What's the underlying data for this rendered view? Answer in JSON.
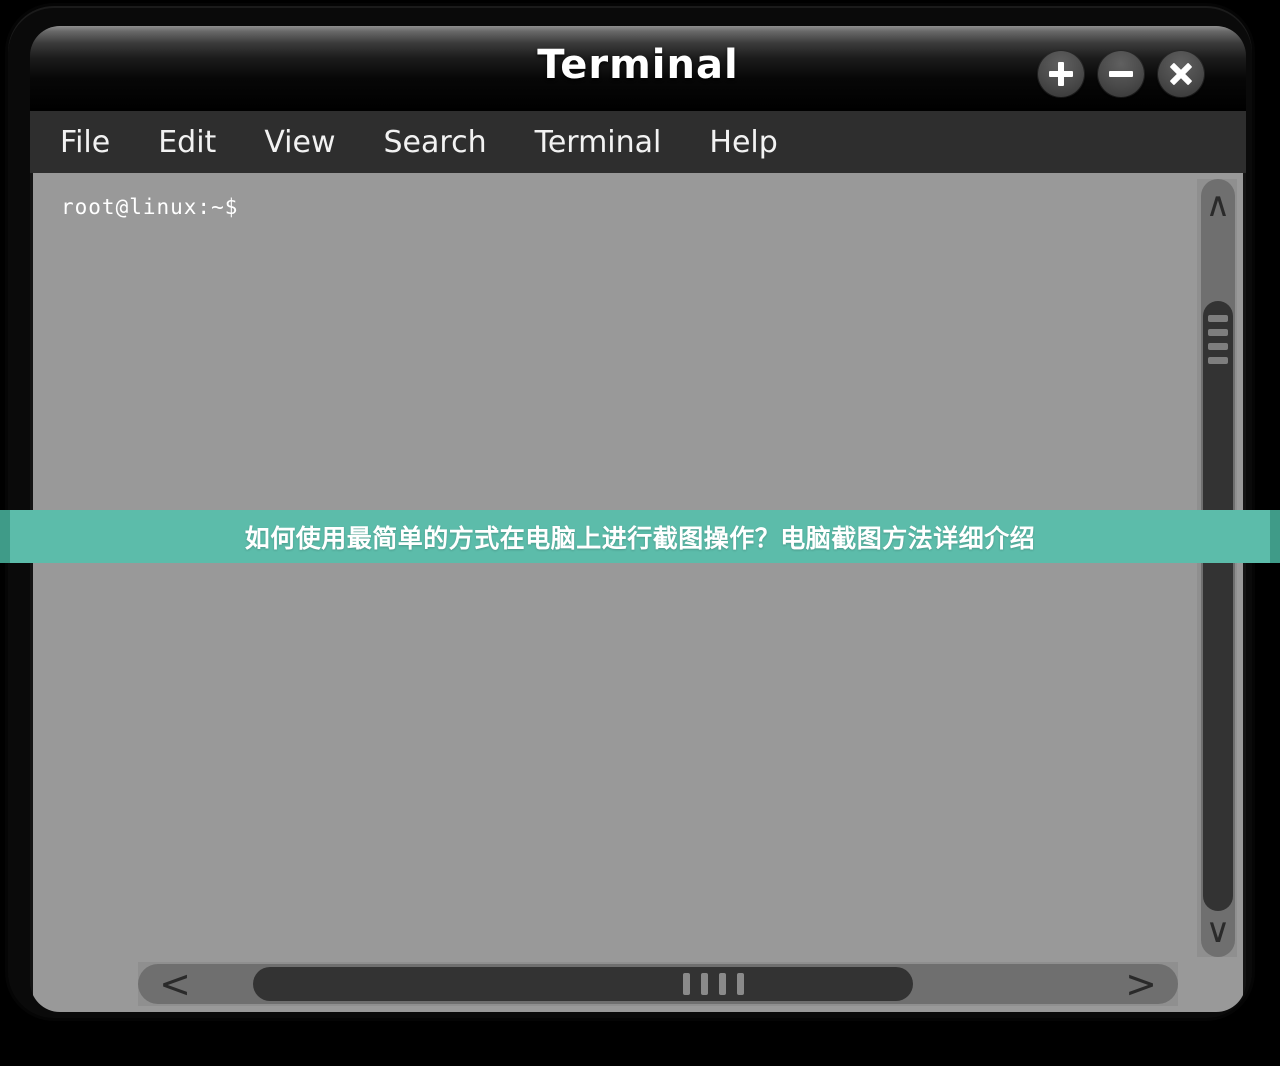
{
  "window": {
    "title": "Terminal",
    "controls": [
      {
        "name": "add-tab-button",
        "label": "+",
        "icon": "plus-icon"
      },
      {
        "name": "minimize-button",
        "label": "−",
        "icon": "minus-icon"
      },
      {
        "name": "close-button",
        "label": "×",
        "icon": "close-icon"
      }
    ]
  },
  "menubar": {
    "items": [
      {
        "label": "File"
      },
      {
        "label": "Edit"
      },
      {
        "label": "View"
      },
      {
        "label": "Search"
      },
      {
        "label": "Terminal"
      },
      {
        "label": "Help"
      }
    ]
  },
  "terminal": {
    "prompt": "root@linux:~$",
    "background_color": "#999999",
    "text_color": "#ffffff"
  },
  "scrollbars": {
    "vertical": {
      "up_arrow": "∧",
      "down_arrow": "∨",
      "thumb_grip_count": 4
    },
    "horizontal": {
      "left_arrow": "<",
      "right_arrow": ">",
      "thumb_grip_count": 4
    }
  },
  "banner": {
    "text": "如何使用最简单的方式在电脑上进行截图操作？电脑截图方法详细介绍",
    "background_color": "#5cbcaa",
    "text_color": "#ffffff"
  }
}
